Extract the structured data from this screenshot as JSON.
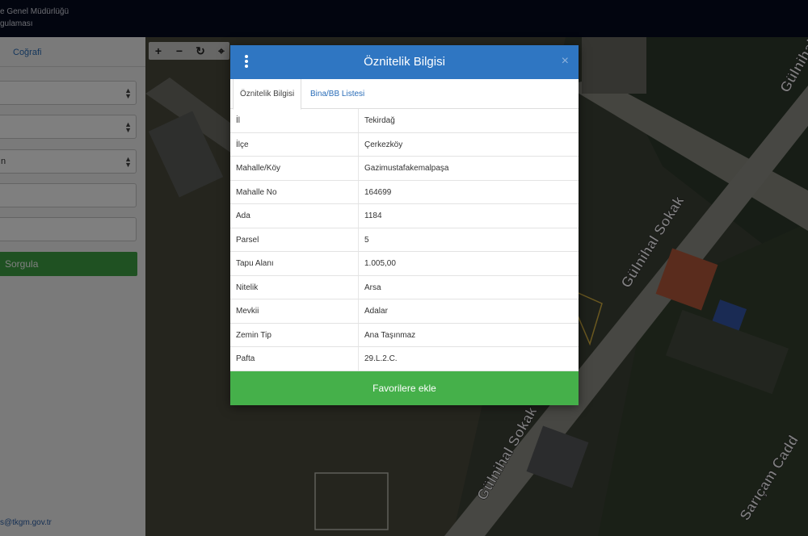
{
  "header": {
    "line1": "e Genel Müdürlüğü",
    "line2": "gulaması"
  },
  "sidebar": {
    "tab_label": "Coğrafi",
    "select_partial": "n",
    "query_button": "Sorgula",
    "email": "s@tkgm.gov.tr"
  },
  "map_toolbar": {
    "zoom_in": "+",
    "zoom_out": "−",
    "refresh": "↻",
    "locate": "⌖"
  },
  "map_labels": {
    "street_top_right": "Gülnihal",
    "street_middle": "Gülnihal Sokak",
    "street_bottom": "Gülnihal Sokak",
    "street_bottom_right": "Sarıçam Cadd"
  },
  "modal": {
    "title": "Öznitelik Bilgisi",
    "close": "×",
    "tabs": [
      "Öznitelik Bilgisi",
      "Bina/BB Listesi"
    ],
    "rows": [
      {
        "key": "İl",
        "value": "Tekirdağ"
      },
      {
        "key": "İlçe",
        "value": "Çerkezköy"
      },
      {
        "key": "Mahalle/Köy",
        "value": "Gazimustafakemalpaşa"
      },
      {
        "key": "Mahalle No",
        "value": "164699"
      },
      {
        "key": "Ada",
        "value": "1184"
      },
      {
        "key": "Parsel",
        "value": "5"
      },
      {
        "key": "Tapu Alanı",
        "value": "1.005,00"
      },
      {
        "key": "Nitelik",
        "value": "Arsa"
      },
      {
        "key": "Mevkii",
        "value": "Adalar"
      },
      {
        "key": "Zemin Tip",
        "value": "Ana Taşınmaz"
      },
      {
        "key": "Pafta",
        "value": "29.L.2.C."
      }
    ],
    "favorite_button": "Favorilere ekle"
  }
}
